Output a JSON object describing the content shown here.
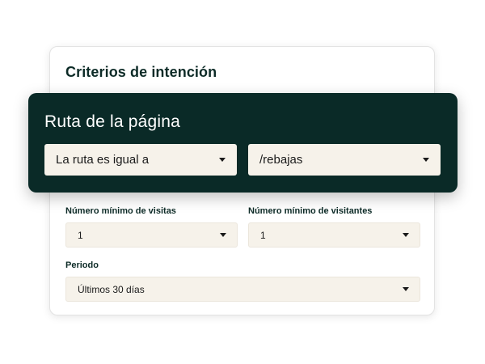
{
  "card": {
    "title": "Criterios de intención"
  },
  "route_panel": {
    "title": "Ruta de la página",
    "condition_select": {
      "value": "La ruta es igual a",
      "icon": "chevron-down-icon"
    },
    "path_select": {
      "value": "/rebajas",
      "icon": "chevron-down-icon"
    }
  },
  "filters": {
    "min_visits": {
      "label": "Número mínimo de visitas",
      "value": "1"
    },
    "min_visitors": {
      "label": "Número mínimo de visitantes",
      "value": "1"
    },
    "period": {
      "label": "Periodo",
      "value": "Últimos 30 días"
    }
  }
}
